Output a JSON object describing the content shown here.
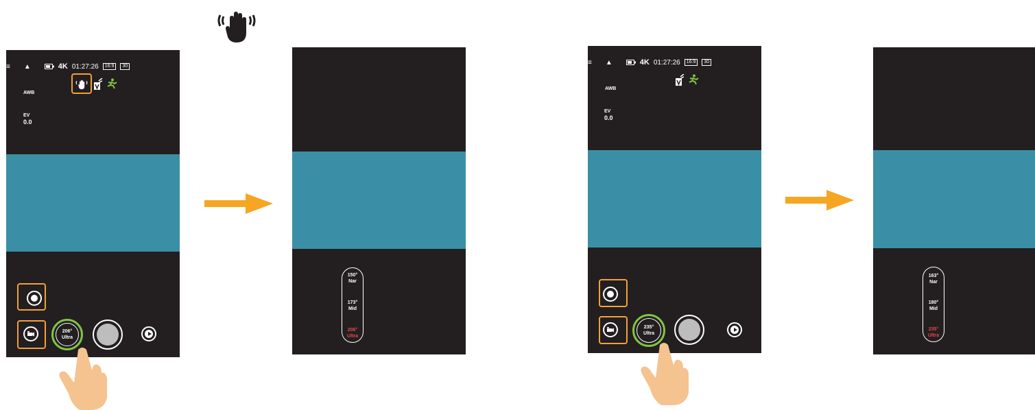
{
  "colors": {
    "accent": "#f2a13a",
    "ring": "#7fc543",
    "preview": "#3a8fa6",
    "screen": "#231f20",
    "selected": "#e8474d"
  },
  "gesture_icon": "palm-wave-icon",
  "panel1": {
    "status": {
      "res": "4K",
      "time": "01:27:26",
      "ratio": "16:9",
      "fps": "30"
    },
    "awb": "AWB",
    "ev_label": "EV",
    "ev_value": "0.0",
    "fov_angle": "206°",
    "fov_name": "Ultra"
  },
  "panel2": {
    "options": [
      {
        "angle": "150°",
        "name": "Nar"
      },
      {
        "angle": "173°",
        "name": "Mid"
      },
      {
        "angle": "206°",
        "name": "Ultra"
      }
    ]
  },
  "panel3": {
    "status": {
      "res": "4K",
      "time": "01:27:26",
      "ratio": "16:9",
      "fps": "30"
    },
    "awb": "AWB",
    "ev_label": "EV",
    "ev_value": "0.0",
    "fov_angle": "235°",
    "fov_name": "Ultra"
  },
  "panel4": {
    "options": [
      {
        "angle": "163°",
        "name": "Nar"
      },
      {
        "angle": "180°",
        "name": "Mid"
      },
      {
        "angle": "235°",
        "name": "Ultra"
      }
    ]
  }
}
